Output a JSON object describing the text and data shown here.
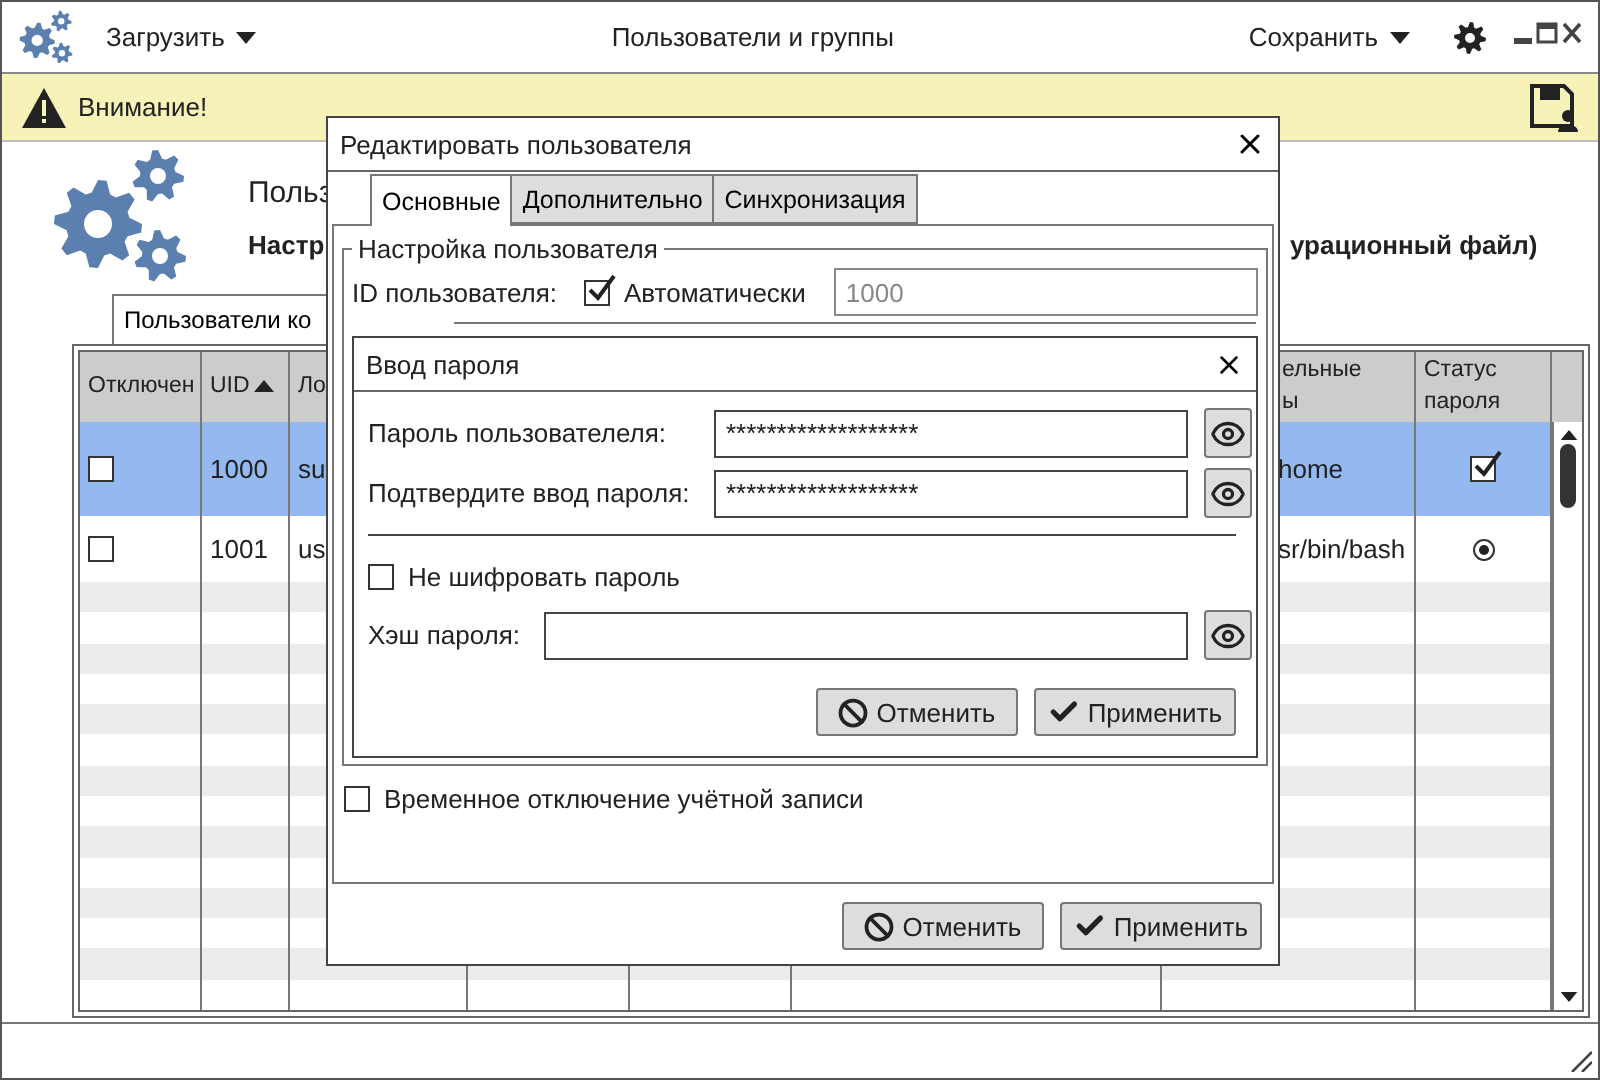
{
  "toolbar": {
    "load_menu": "Загрузить",
    "title": "Пользователи и группы",
    "save_menu": "Сохранить"
  },
  "warning": {
    "text": "Внимание!"
  },
  "header": {
    "title": "Польз",
    "subtitle_start": "Настр",
    "subtitle_end": "урационный файл)"
  },
  "page_tab": {
    "label": "Пользователи ко",
    "selected": true
  },
  "table": {
    "columns": [
      {
        "label": "Отключен"
      },
      {
        "label": "UID",
        "sort_ascending": true
      },
      {
        "label": "Ло"
      },
      {
        "label": "ельные\nы"
      },
      {
        "label": "Статус пароля"
      }
    ],
    "rows": [
      {
        "selected": true,
        "disabled": false,
        "uid": "1000",
        "login": "su",
        "column_7": "home",
        "password_status": {
          "kind": "checkbox",
          "on": true
        }
      },
      {
        "selected": false,
        "disabled": false,
        "uid": "1001",
        "login": "us",
        "column_7": "sr/bin/bash",
        "password_status": {
          "kind": "radio",
          "on": true
        }
      }
    ]
  },
  "edit_dialog": {
    "title": "Редактировать пользователя",
    "tabs": [
      {
        "label": "Основные",
        "selected": true
      },
      {
        "label": "Дополнительно",
        "selected": false
      },
      {
        "label": "Синхронизация",
        "selected": false
      }
    ],
    "group_title": "Настройка пользователя",
    "id_label": "ID пользователя:",
    "auto_id": {
      "label": "Автоматически",
      "checked": true
    },
    "id_value": "1000",
    "id_disabled": true,
    "disable_account": {
      "label": "Временное отключение учётной записи",
      "checked": false
    },
    "buttons": [
      {
        "kind": "cancel",
        "label": "Отменить"
      },
      {
        "kind": "apply",
        "label": "Применить"
      }
    ]
  },
  "password_dialog": {
    "title": "Ввод пароля",
    "fields": [
      {
        "label": "Пароль пользователеля:",
        "value": "*******************"
      },
      {
        "label": "Подтвердите ввод пароля:",
        "value": "*******************"
      }
    ],
    "no_encrypt": {
      "label": "Не шифровать пароль",
      "checked": false
    },
    "hash_label": "Хэш пароля:",
    "buttons": [
      {
        "kind": "cancel",
        "label": "Отменить"
      },
      {
        "kind": "apply",
        "label": "Применить"
      }
    ]
  }
}
